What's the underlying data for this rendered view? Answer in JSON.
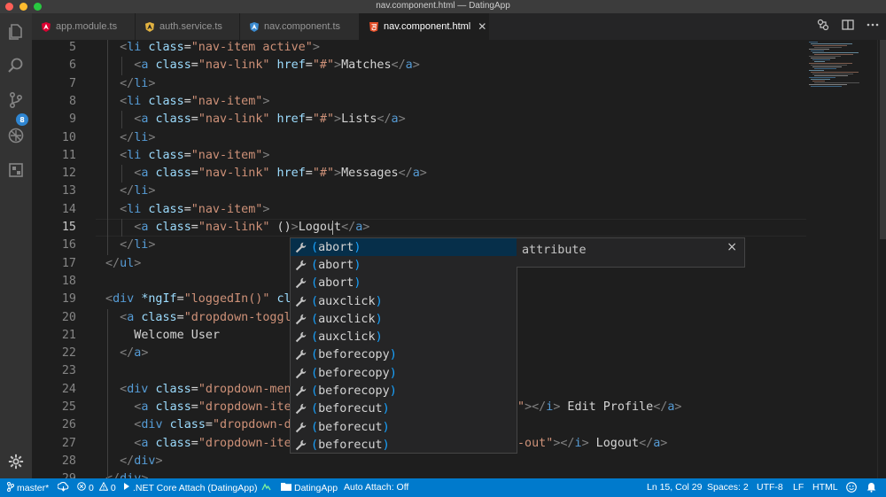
{
  "window": {
    "title": "nav.component.html — DatingApp"
  },
  "activity_bar": {
    "source_control_badge": "8"
  },
  "tabs": [
    {
      "label": "app.module.ts",
      "icon": "angular-icon",
      "active": false
    },
    {
      "label": "auth.service.ts",
      "icon": "angular-service-icon",
      "active": false
    },
    {
      "label": "nav.component.ts",
      "icon": "angular-component-icon",
      "active": false
    },
    {
      "label": "nav.component.html",
      "icon": "html5-icon",
      "active": true
    }
  ],
  "tab_close_glyph": "✕",
  "editor": {
    "lines": [
      {
        "n": "5",
        "segments": [
          [
            "punct",
            "<"
          ],
          [
            "tag",
            "li"
          ],
          [
            "text",
            " "
          ],
          [
            "attr",
            "class"
          ],
          [
            "text",
            "="
          ],
          [
            "str",
            "\"nav-item active\""
          ],
          [
            "punct",
            ">"
          ]
        ],
        "indent": 1
      },
      {
        "n": "6",
        "segments": [
          [
            "punct",
            "<"
          ],
          [
            "tag",
            "a"
          ],
          [
            "text",
            " "
          ],
          [
            "attr",
            "class"
          ],
          [
            "text",
            "="
          ],
          [
            "str",
            "\"nav-link\""
          ],
          [
            "text",
            " "
          ],
          [
            "attr",
            "href"
          ],
          [
            "text",
            "="
          ],
          [
            "str",
            "\"#\""
          ],
          [
            "punct",
            ">"
          ],
          [
            "text",
            "Matches"
          ],
          [
            "punct",
            "</"
          ],
          [
            "tag",
            "a"
          ],
          [
            "punct",
            ">"
          ]
        ],
        "indent": 2
      },
      {
        "n": "7",
        "segments": [
          [
            "punct",
            "</"
          ],
          [
            "tag",
            "li"
          ],
          [
            "punct",
            ">"
          ]
        ],
        "indent": 1
      },
      {
        "n": "8",
        "segments": [
          [
            "punct",
            "<"
          ],
          [
            "tag",
            "li"
          ],
          [
            "text",
            " "
          ],
          [
            "attr",
            "class"
          ],
          [
            "text",
            "="
          ],
          [
            "str",
            "\"nav-item\""
          ],
          [
            "punct",
            ">"
          ]
        ],
        "indent": 1
      },
      {
        "n": "9",
        "segments": [
          [
            "punct",
            "<"
          ],
          [
            "tag",
            "a"
          ],
          [
            "text",
            " "
          ],
          [
            "attr",
            "class"
          ],
          [
            "text",
            "="
          ],
          [
            "str",
            "\"nav-link\""
          ],
          [
            "text",
            " "
          ],
          [
            "attr",
            "href"
          ],
          [
            "text",
            "="
          ],
          [
            "str",
            "\"#\""
          ],
          [
            "punct",
            ">"
          ],
          [
            "text",
            "Lists"
          ],
          [
            "punct",
            "</"
          ],
          [
            "tag",
            "a"
          ],
          [
            "punct",
            ">"
          ]
        ],
        "indent": 2
      },
      {
        "n": "10",
        "segments": [
          [
            "punct",
            "</"
          ],
          [
            "tag",
            "li"
          ],
          [
            "punct",
            ">"
          ]
        ],
        "indent": 1
      },
      {
        "n": "11",
        "segments": [
          [
            "punct",
            "<"
          ],
          [
            "tag",
            "li"
          ],
          [
            "text",
            " "
          ],
          [
            "attr",
            "class"
          ],
          [
            "text",
            "="
          ],
          [
            "str",
            "\"nav-item\""
          ],
          [
            "punct",
            ">"
          ]
        ],
        "indent": 1
      },
      {
        "n": "12",
        "segments": [
          [
            "punct",
            "<"
          ],
          [
            "tag",
            "a"
          ],
          [
            "text",
            " "
          ],
          [
            "attr",
            "class"
          ],
          [
            "text",
            "="
          ],
          [
            "str",
            "\"nav-link\""
          ],
          [
            "text",
            " "
          ],
          [
            "attr",
            "href"
          ],
          [
            "text",
            "="
          ],
          [
            "str",
            "\"#\""
          ],
          [
            "punct",
            ">"
          ],
          [
            "text",
            "Messages"
          ],
          [
            "punct",
            "</"
          ],
          [
            "tag",
            "a"
          ],
          [
            "punct",
            ">"
          ]
        ],
        "indent": 2
      },
      {
        "n": "13",
        "segments": [
          [
            "punct",
            "</"
          ],
          [
            "tag",
            "li"
          ],
          [
            "punct",
            ">"
          ]
        ],
        "indent": 1
      },
      {
        "n": "14",
        "segments": [
          [
            "punct",
            "<"
          ],
          [
            "tag",
            "li"
          ],
          [
            "text",
            " "
          ],
          [
            "attr",
            "class"
          ],
          [
            "text",
            "="
          ],
          [
            "str",
            "\"nav-item\""
          ],
          [
            "punct",
            ">"
          ]
        ],
        "indent": 1
      },
      {
        "n": "15",
        "segments": [
          [
            "punct",
            "<"
          ],
          [
            "tag",
            "a"
          ],
          [
            "text",
            " "
          ],
          [
            "attr",
            "class"
          ],
          [
            "text",
            "="
          ],
          [
            "str",
            "\"nav-link\""
          ],
          [
            "text",
            " "
          ],
          [
            "text",
            "()"
          ],
          [
            "punct",
            ">"
          ],
          [
            "text",
            "Logout"
          ],
          [
            "punct",
            "</"
          ],
          [
            "tag",
            "a"
          ],
          [
            "punct",
            ">"
          ]
        ],
        "indent": 2,
        "current": true
      },
      {
        "n": "16",
        "segments": [
          [
            "punct",
            "</"
          ],
          [
            "tag",
            "li"
          ],
          [
            "punct",
            ">"
          ]
        ],
        "indent": 1
      },
      {
        "n": "17",
        "segments": [
          [
            "punct",
            "</"
          ],
          [
            "tag",
            "ul"
          ],
          [
            "punct",
            ">"
          ]
        ],
        "indent": 0
      },
      {
        "n": "18",
        "segments": [],
        "indent": 0
      },
      {
        "n": "19",
        "segments": [
          [
            "punct",
            "<"
          ],
          [
            "tag",
            "div"
          ],
          [
            "text",
            " "
          ],
          [
            "attr",
            "*ngIf"
          ],
          [
            "text",
            "="
          ],
          [
            "str",
            "\"loggedIn()\""
          ],
          [
            "text",
            " "
          ],
          [
            "attr",
            "cl"
          ]
        ],
        "indent": 0
      },
      {
        "n": "20",
        "segments": [
          [
            "punct",
            "<"
          ],
          [
            "tag",
            "a"
          ],
          [
            "text",
            " "
          ],
          [
            "attr",
            "class"
          ],
          [
            "text",
            "="
          ],
          [
            "str",
            "\"dropdown-toggl"
          ]
        ],
        "indent": 1
      },
      {
        "n": "21",
        "segments": [
          [
            "text",
            "Welcome User"
          ]
        ],
        "indent": 2
      },
      {
        "n": "22",
        "segments": [
          [
            "punct",
            "</"
          ],
          [
            "tag",
            "a"
          ],
          [
            "punct",
            ">"
          ]
        ],
        "indent": 1
      },
      {
        "n": "23",
        "segments": [],
        "indent": 0
      },
      {
        "n": "24",
        "segments": [
          [
            "punct",
            "<"
          ],
          [
            "tag",
            "div"
          ],
          [
            "text",
            " "
          ],
          [
            "attr",
            "class"
          ],
          [
            "text",
            "="
          ],
          [
            "str",
            "\"dropdown-men"
          ]
        ],
        "indent": 1
      },
      {
        "n": "25",
        "segments": [
          [
            "punct",
            "<"
          ],
          [
            "tag",
            "a"
          ],
          [
            "text",
            " "
          ],
          [
            "attr",
            "class"
          ],
          [
            "text",
            "="
          ],
          [
            "str",
            "\"dropdown-ite"
          ]
        ],
        "indent": 2,
        "tail": [
          [
            "str",
            "\""
          ],
          [
            "punct",
            ">"
          ],
          [
            "punct",
            "</"
          ],
          [
            "tag",
            "i"
          ],
          [
            "punct",
            ">"
          ],
          [
            "text",
            " Edit Profile"
          ],
          [
            "punct",
            "</"
          ],
          [
            "tag",
            "a"
          ],
          [
            "punct",
            ">"
          ]
        ]
      },
      {
        "n": "26",
        "segments": [
          [
            "punct",
            "<"
          ],
          [
            "tag",
            "div"
          ],
          [
            "text",
            " "
          ],
          [
            "attr",
            "class"
          ],
          [
            "text",
            "="
          ],
          [
            "str",
            "\"dropdown-d"
          ]
        ],
        "indent": 2
      },
      {
        "n": "27",
        "segments": [
          [
            "punct",
            "<"
          ],
          [
            "tag",
            "a"
          ],
          [
            "text",
            " "
          ],
          [
            "attr",
            "class"
          ],
          [
            "text",
            "="
          ],
          [
            "str",
            "\"dropdown-ite"
          ]
        ],
        "indent": 2,
        "tail": [
          [
            "str",
            "-out\""
          ],
          [
            "punct",
            ">"
          ],
          [
            "punct",
            "</"
          ],
          [
            "tag",
            "i"
          ],
          [
            "punct",
            ">"
          ],
          [
            "text",
            " Logout"
          ],
          [
            "punct",
            "</"
          ],
          [
            "tag",
            "a"
          ],
          [
            "punct",
            ">"
          ]
        ]
      },
      {
        "n": "28",
        "segments": [
          [
            "punct",
            "</"
          ],
          [
            "tag",
            "div"
          ],
          [
            "punct",
            ">"
          ]
        ],
        "indent": 1
      },
      {
        "n": "29",
        "segments": [
          [
            "punct",
            "</"
          ],
          [
            "tag",
            "div"
          ],
          [
            "punct",
            ">"
          ]
        ],
        "indent": 0
      }
    ]
  },
  "suggest": {
    "items": [
      {
        "label": "(abort)",
        "selected": true
      },
      {
        "label": "(abort)"
      },
      {
        "label": "(abort)"
      },
      {
        "label": "(auxclick)"
      },
      {
        "label": "(auxclick)"
      },
      {
        "label": "(auxclick)"
      },
      {
        "label": "(beforecopy)"
      },
      {
        "label": "(beforecopy)"
      },
      {
        "label": "(beforecopy)"
      },
      {
        "label": "(beforecut)"
      },
      {
        "label": "(beforecut)"
      },
      {
        "label": "(beforecut)"
      }
    ],
    "details_label": "attribute",
    "details_close": "×"
  },
  "statusbar": {
    "branch": "master*",
    "errors": "0",
    "warnings": "0",
    "debug": ".NET Core Attach (DatingApp)",
    "folder": "DatingApp",
    "auto_attach": "Auto Attach: Off",
    "position": "Ln 15, Col 29",
    "spaces": "Spaces: 2",
    "encoding": "UTF-8",
    "eol": "LF",
    "language": "HTML"
  },
  "colors": {
    "accent": "#007acc",
    "close_dot": "#ff5f57",
    "min_dot": "#febc2e",
    "max_dot": "#28c840"
  }
}
